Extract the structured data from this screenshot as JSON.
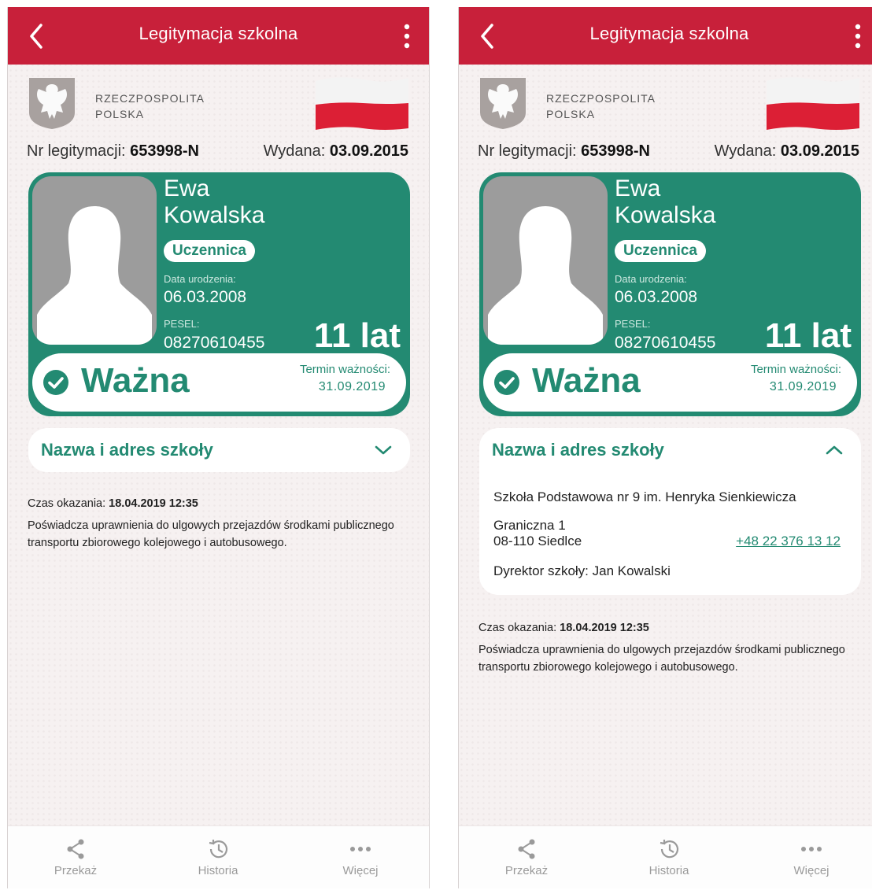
{
  "screens": [
    {
      "topbar": {
        "title": "Legitymacja szkolna"
      },
      "issuer": {
        "line1": "RZECZPOSPOLITA",
        "line2": "POLSKA"
      },
      "document": {
        "nr_label": "Nr legitymacji:",
        "nr_value": "653998-N",
        "issued_label": "Wydana:",
        "issued_value": "03.09.2015"
      },
      "card": {
        "first_name": "Ewa",
        "last_name": "Kowalska",
        "role": "Uczennica",
        "birth_label": "Data urodzenia:",
        "birth_value": "06.03.2008",
        "pesel_label": "PESEL:",
        "pesel_value": "08270610455",
        "age": "11 lat",
        "status": "Ważna",
        "expiry_label": "Termin ważności:",
        "expiry_value": "31.09.2019"
      },
      "school": {
        "heading": "Nazwa i adres szkoły",
        "expanded": false
      },
      "info": {
        "shown_label": "Czas okazania:",
        "shown_value": "18.04.2019 12:35",
        "privilege": "Poświadcza uprawnienia do ulgowych przejazdów środkami publicznego transportu zbiorowego kolejowego i autobusowego."
      },
      "nav": {
        "share": "Przekaż",
        "history": "Historia",
        "more": "Więcej"
      }
    },
    {
      "topbar": {
        "title": "Legitymacja szkolna"
      },
      "issuer": {
        "line1": "RZECZPOSPOLITA",
        "line2": "POLSKA"
      },
      "document": {
        "nr_label": "Nr legitymacji:",
        "nr_value": "653998-N",
        "issued_label": "Wydana:",
        "issued_value": "03.09.2015"
      },
      "card": {
        "first_name": "Ewa",
        "last_name": "Kowalska",
        "role": "Uczennica",
        "birth_label": "Data urodzenia:",
        "birth_value": "06.03.2008",
        "pesel_label": "PESEL:",
        "pesel_value": "08270610455",
        "age": "11 lat",
        "status": "Ważna",
        "expiry_label": "Termin ważności:",
        "expiry_value": "31.09.2019"
      },
      "school": {
        "heading": "Nazwa i adres szkoły",
        "expanded": true,
        "name": "Szkoła Podstawowa nr 9 im. Henryka Sienkiewicza",
        "street": "Graniczna 1",
        "city": "08-110 Siedlce",
        "phone": "+48 22 376 13 12",
        "director": "Dyrektor szkoły: Jan Kowalski"
      },
      "info": {
        "shown_label": "Czas okazania:",
        "shown_value": "18.04.2019 12:35",
        "privilege": "Poświadcza uprawnienia do ulgowych przejazdów środkami publicznego transportu zbiorowego kolejowego i autobusowego."
      },
      "nav": {
        "share": "Przekaż",
        "history": "Historia",
        "more": "Więcej"
      }
    }
  ],
  "colors": {
    "brand_red": "#c8203a",
    "card_green": "#238a72",
    "background": "#f6f1f1"
  },
  "icons": [
    "back-arrow-icon",
    "kebab-menu-icon",
    "eagle-emblem-icon",
    "polish-flag-icon",
    "check-circle-icon",
    "chevron-down-icon",
    "chevron-up-icon",
    "share-icon",
    "history-icon",
    "more-dots-icon"
  ]
}
